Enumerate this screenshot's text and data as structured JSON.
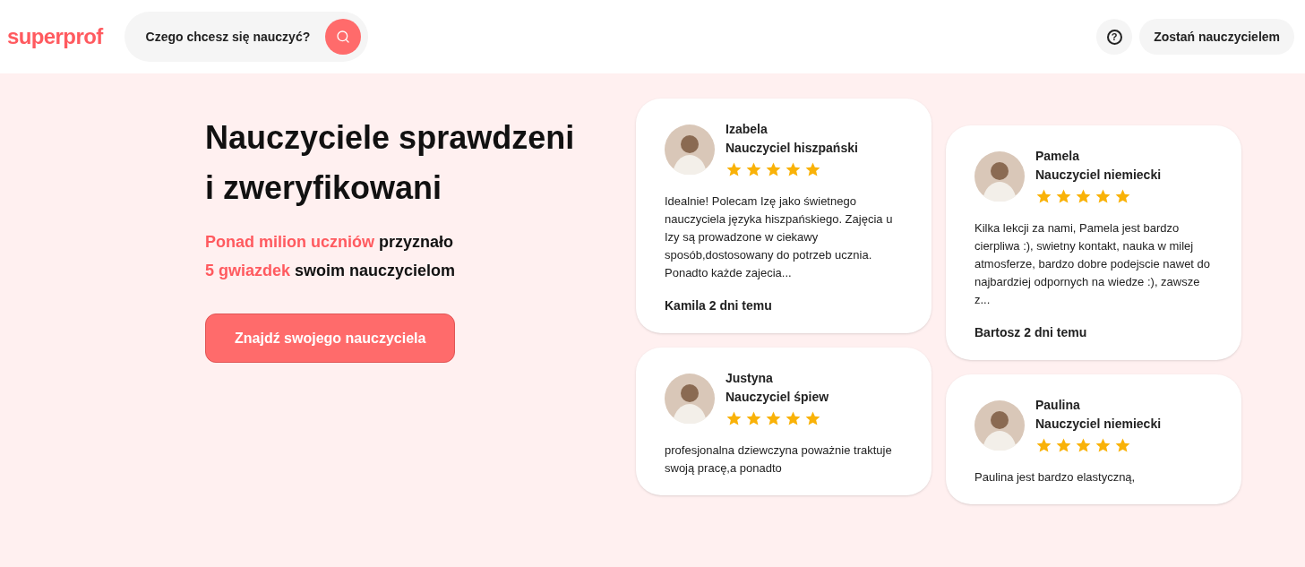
{
  "header": {
    "logo": "superprof",
    "search": {
      "placeholder": "Czego chcesz się nauczyć?"
    },
    "help_button": "?",
    "cta": "Zostań nauczycielem"
  },
  "hero": {
    "title": "Nauczyciele sprawdzeni i zweryfikowani",
    "subtitle": "**Ponad milion uczniów** przyznało\n**5 gwiazdek** swoim nauczycielom",
    "button": "Znajdź swojego nauczyciela"
  },
  "reviews": [
    {
      "name": "Izabela",
      "subject": "Nauczyciel hiszpański",
      "stars": 5,
      "text": "Idealnie! Polecam Izę jako świetnego nauczyciela języka hiszpańskiego. Zajęcia u Izy są prowadzone w ciekawy sposób,dostosowany do potrzeb ucznia. Ponadto każde zajecia...",
      "author": "Kamila 2 dni temu"
    },
    {
      "name": "Pamela",
      "subject": "Nauczyciel niemiecki",
      "stars": 5,
      "text": "Kilka lekcji za nami, Pamela jest bardzo cierpliwa :), swietny kontakt, nauka w milej atmosferze, bardzo dobre podejscie nawet do najbardziej odpornych na wiedze :), zawsze z...",
      "author": "Bartosz 2 dni temu"
    },
    {
      "name": "Justyna",
      "subject": "Nauczyciel śpiew",
      "stars": 5,
      "text": "profesjonalna dziewczyna poważnie traktuje swoją pracę,a ponadto"
    },
    {
      "name": "Paulina",
      "subject": "Nauczyciel niemiecki",
      "stars": 5,
      "text": "Paulina jest bardzo elastyczną,"
    }
  ]
}
